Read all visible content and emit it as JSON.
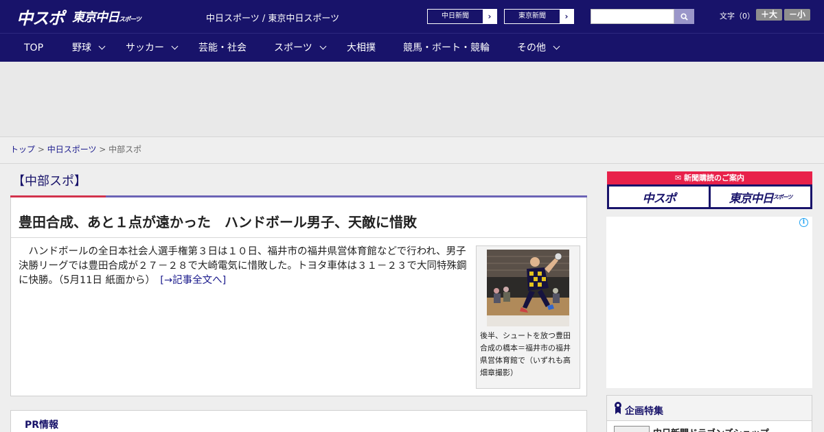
{
  "header": {
    "logo_main": "中スポ",
    "logo_sub": "東京中日",
    "logo_sub_small": "スポーツ",
    "site_title": "中日スポーツ / 東京中日スポーツ",
    "paper_links": [
      {
        "label": "中日新聞"
      },
      {
        "label": "東京新聞"
      }
    ],
    "search_placeholder": "",
    "font_size_label": "文字（0）",
    "font_increase": "＋大",
    "font_decrease": "－小"
  },
  "nav": {
    "items": [
      {
        "label": "TOP",
        "has_dropdown": false
      },
      {
        "label": "野球",
        "has_dropdown": true
      },
      {
        "label": "サッカー",
        "has_dropdown": true
      },
      {
        "label": "芸能・社会",
        "has_dropdown": false
      },
      {
        "label": "スポーツ",
        "has_dropdown": true
      },
      {
        "label": "大相撲",
        "has_dropdown": false
      },
      {
        "label": "競馬・ボート・競輪",
        "has_dropdown": false
      },
      {
        "label": "その他",
        "has_dropdown": true
      }
    ]
  },
  "breadcrumb": {
    "home": "トップ",
    "sep": " > ",
    "section": "中日スポーツ",
    "current": "中部スポ"
  },
  "article": {
    "section_title": "【中部スポ】",
    "headline": "豊田合成、あと１点が遠かった　ハンドボール男子、天敵に惜敗",
    "body": "　ハンドボールの全日本社会人選手権第３日は１０日、福井市の福井県営体育館などで行われ、男子決勝リーグでは豊田合成が２７－２８で大崎電気に惜敗した。トヨタ車体は３１－２３で大同特殊鋼に快勝。（5月11日 紙面から）　",
    "more_link": "[→記事全文へ]",
    "photo_caption": "後半、シュートを放つ豊田合成の橋本＝福井市の福井県営体育館で（いずれも高畑章撮影）"
  },
  "pr": {
    "title": "PR情報"
  },
  "sidebar": {
    "subscription_title": "新聞購読のご案内",
    "sub_logo_1": "中スポ",
    "sub_logo_2": "東京中日",
    "sub_logo_2_small": "スポーツ",
    "feature_title": "企画特集",
    "feature_item": "中日新聞ドラゴンズショップ"
  },
  "colors": {
    "brand_navy": "#18136a",
    "accent_red": "#d2324c",
    "accent_purple": "#6b63b5",
    "subscribe_red": "#e8214a"
  }
}
